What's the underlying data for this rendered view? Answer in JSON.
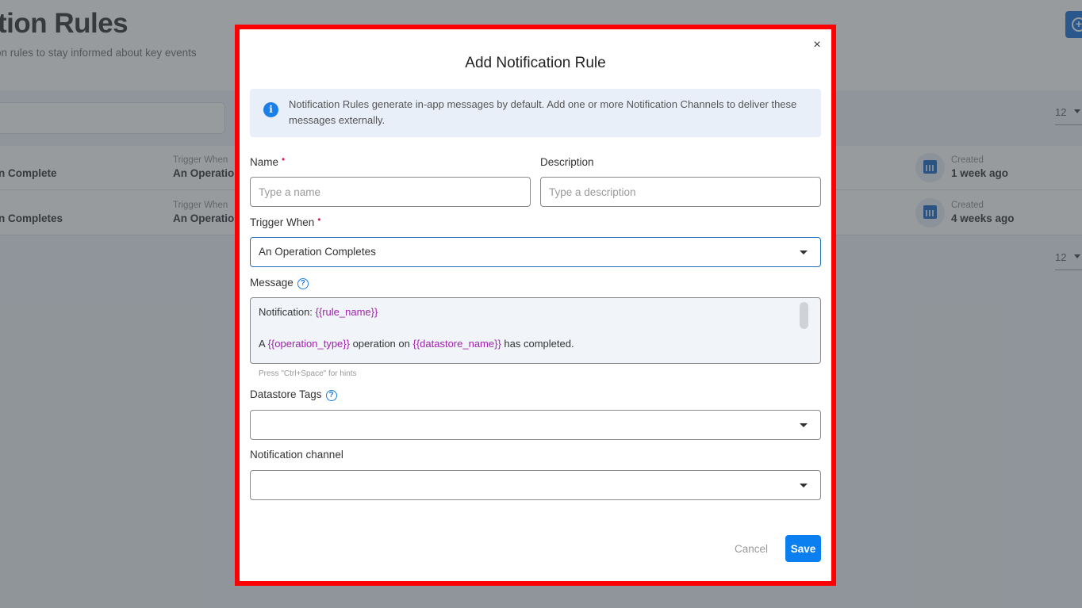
{
  "background": {
    "page_title": "ation Rules",
    "page_subtitle": "on rules to stay informed about key events",
    "page_size_top": "12",
    "page_size_bottom": "12",
    "rules": [
      {
        "name": "ion Complete",
        "trigger_label": "Trigger When",
        "trigger_value": "An Operation",
        "created_label": "Created",
        "created_value": "1 week ago"
      },
      {
        "name": "ion Completes",
        "trigger_label": "Trigger When",
        "trigger_value": "An Operation",
        "created_label": "Created",
        "created_value": "4 weeks ago"
      }
    ]
  },
  "modal": {
    "title": "Add Notification Rule",
    "close_glyph": "×",
    "info_text": "Notification Rules generate in-app messages by default. Add one or more Notification Channels to deliver these messages externally.",
    "info_glyph": "i",
    "name": {
      "label": "Name",
      "required_mark": "•",
      "placeholder": "Type a name",
      "value": ""
    },
    "description": {
      "label": "Description",
      "placeholder": "Type a description",
      "value": ""
    },
    "trigger_when": {
      "label": "Trigger When",
      "required_mark": "•",
      "value": "An Operation Completes"
    },
    "message": {
      "label": "Message",
      "help_glyph": "?",
      "line1_prefix": "Notification: ",
      "line1_var": "{{rule_name}}",
      "line2_prefix": "A ",
      "line2_var1": "{{operation_type}}",
      "line2_mid": " operation on ",
      "line2_var2": "{{datastore_name}}",
      "line2_suffix": " has completed.",
      "hint": "Press \"Ctrl+Space\" for hints"
    },
    "datastore_tags": {
      "label": "Datastore Tags",
      "help_glyph": "?",
      "value": ""
    },
    "notification_channel": {
      "label": "Notification channel",
      "value": ""
    },
    "cancel_label": "Cancel",
    "save_label": "Save"
  },
  "colors": {
    "accent": "#0b7ef0",
    "required": "#e0195a",
    "template_var": "#a020b0",
    "highlight_border": "#ff0000"
  }
}
